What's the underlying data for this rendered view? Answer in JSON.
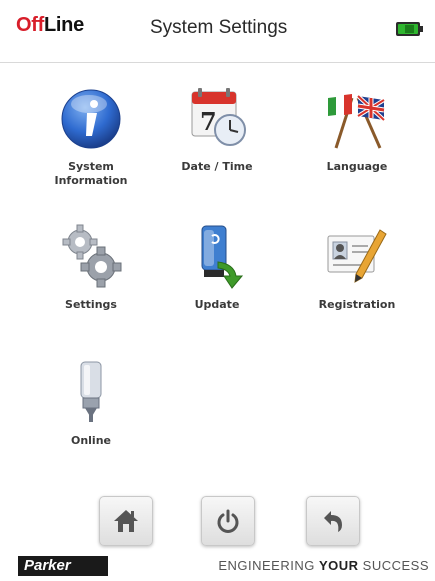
{
  "header": {
    "status_off": "Off",
    "status_line": "Line",
    "title": "System Settings",
    "battery_icon": "battery-icon",
    "status_color": "#d81e2a"
  },
  "grid": {
    "system_info_line1": "System",
    "system_info_line2": "Information",
    "date_time": "Date / Time",
    "language": "Language",
    "settings": "Settings",
    "update": "Update",
    "registration": "Registration",
    "online": "Online"
  },
  "footer": {
    "home_icon": "home-icon",
    "power_icon": "power-icon",
    "back_icon": "back-icon"
  },
  "brand": {
    "logo": "Parker",
    "slogan_1": "ENGINEERING ",
    "slogan_2": "YOUR",
    "slogan_3": " SUCCESS"
  },
  "colors": {
    "accent_blue": "#2f6bd0",
    "calendar_red": "#d8342c",
    "update_green": "#3f9a2a"
  }
}
